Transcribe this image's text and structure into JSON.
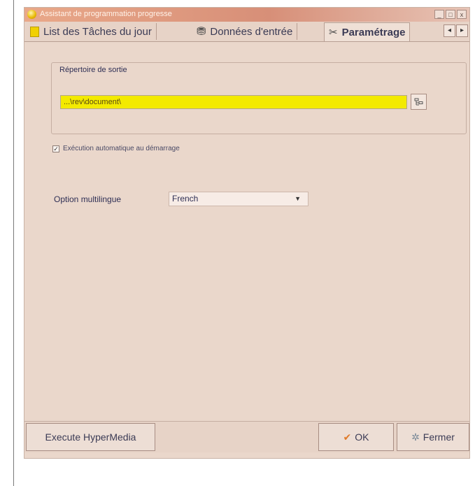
{
  "window": {
    "title": "Assistant de programmation progresse",
    "controls": [
      "_",
      "□",
      "x"
    ]
  },
  "tabs": [
    {
      "label": "List des Tâches du jour",
      "icon": "note-icon"
    },
    {
      "label": "Données d'entrée",
      "icon": "database-icon"
    },
    {
      "label": "Paramétrage",
      "icon": "tools-icon",
      "active": true
    }
  ],
  "tab_scroll": {
    "left": "◂",
    "right": "▸"
  },
  "output_group": {
    "title": "Répertoire de sortie",
    "path_value": "...\\rev\\document\\"
  },
  "auto_option": {
    "checked": true,
    "label": "Exécution automatique au démarrage"
  },
  "language": {
    "label": "Option multilingue",
    "selected": "French"
  },
  "bottom": {
    "execute_label": "Execute HyperMedia",
    "ok_label": "OK",
    "close_label": "Fermer"
  },
  "colors": {
    "path_field": "#f3ea00",
    "window_bg": "#ead7cb"
  }
}
